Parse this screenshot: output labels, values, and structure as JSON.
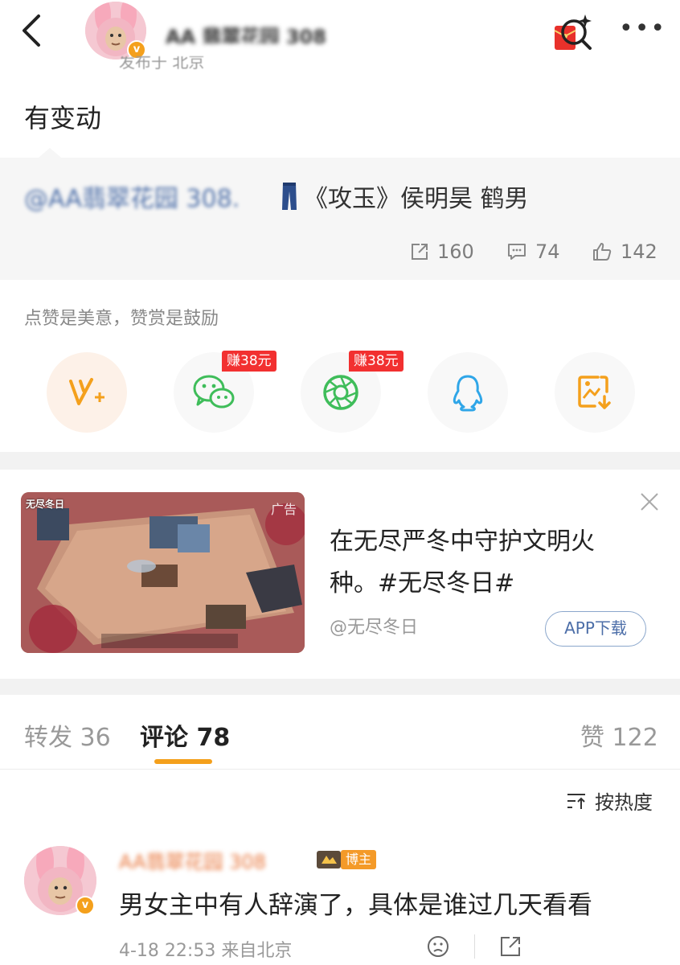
{
  "header": {
    "username": "AA 翡翠花园 308",
    "sub_info": "发布于 北京",
    "more_label": "•••"
  },
  "post": {
    "text": "有变动"
  },
  "quote": {
    "mention": "@AA翡翠花园 308.",
    "title": "《攻玉》侯明昊 鹤男",
    "reposts": "160",
    "comments": "74",
    "likes": "142"
  },
  "reward": {
    "label": "点赞是美意，赞赏是鼓励",
    "items": [
      {
        "icon": "v-plus-icon"
      },
      {
        "icon": "wechat-icon",
        "badge": "赚38元"
      },
      {
        "icon": "moments-icon",
        "badge": "赚38元"
      },
      {
        "icon": "qq-icon"
      },
      {
        "icon": "save-image-icon"
      }
    ]
  },
  "ad": {
    "image_title": "无尽冬日",
    "ad_tag": "广告",
    "text": "在无尽严冬中守护文明火种。#无尽冬日#",
    "source": "@无尽冬日",
    "download_label": "APP下载"
  },
  "tabs": {
    "repost": "转发 36",
    "comment": "评论 78",
    "like": "赞 122"
  },
  "sort": {
    "label": "按热度"
  },
  "comment": {
    "author": "AA翡翠花园 308",
    "badge": "博主",
    "text": "男女主中有人辞演了，具体是谁过几天看看",
    "meta": "4-18 22:53 来自北京"
  },
  "colors": {
    "accent": "#f4a01c",
    "link": "#4c6ea8",
    "badge_red": "#f23030",
    "wechat_green": "#3fbd5a"
  }
}
